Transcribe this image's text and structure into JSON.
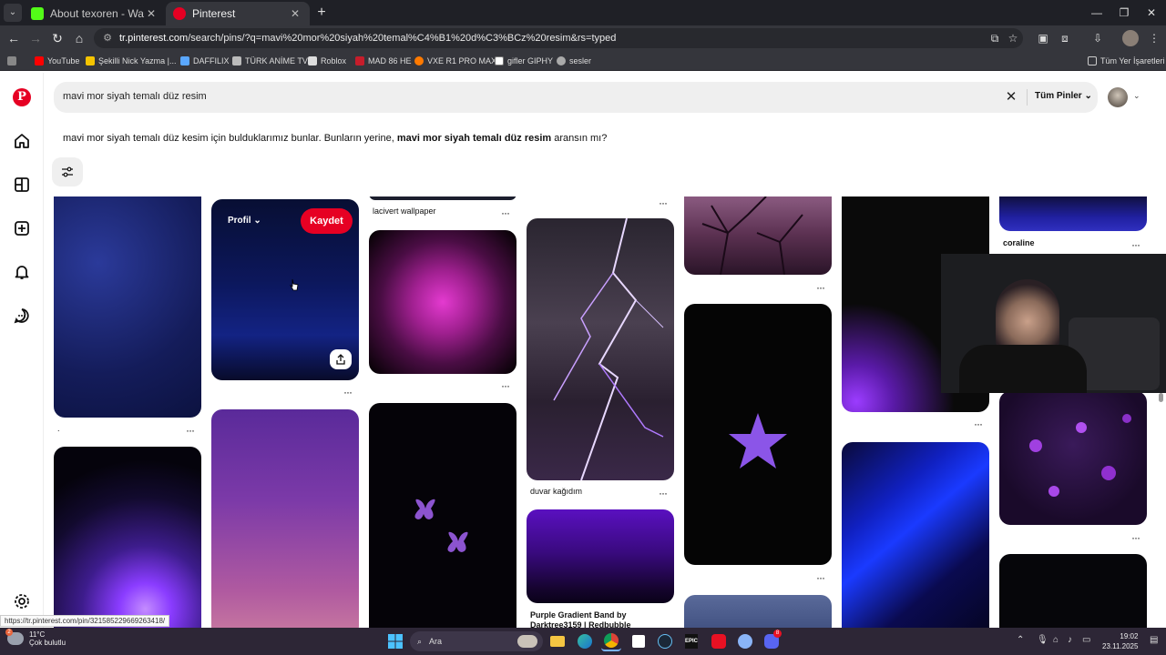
{
  "browser": {
    "tabs": [
      {
        "title": "About texoren - Watch Live on",
        "favicon_color": "#53fc18",
        "active": false
      },
      {
        "title": "Pinterest",
        "favicon_color": "#e60023",
        "active": true
      }
    ],
    "url_host": "tr.pinterest.com",
    "url_path": "/search/pins/?q=mavi%20mor%20siyah%20temal%C4%B1%20d%C3%BCz%20resim&rs=typed",
    "bookmarks": [
      "YouTube",
      "Şekilli Nick Yazma |...",
      "DAFFILIX",
      "TÜRK ANİME TV",
      "Roblox",
      "MAD 86 HE",
      "VXE R1 PRO MAX",
      "gifler GIPHY",
      "sesler"
    ],
    "all_bookmarks_label": "Tüm Yer İşaretleri"
  },
  "search": {
    "query": "mavi mor siyah temalı düz resim",
    "scope_label": "Tüm Pinler"
  },
  "suggestion": {
    "prefix": "mavi mor siyah temalı düz kesim için bulduklarımız bunlar. Bunların yerine, ",
    "term": "mavi mor siyah temalı düz resim",
    "suffix": " aransın mı?"
  },
  "pins": {
    "hover_profile": "Profil",
    "save_button": "Kaydet",
    "captions": {
      "lacivert": "lacivert wallpaper",
      "duvar": "duvar kağıdım",
      "purple_band_1": "Purple Gradient Band by",
      "purple_band_2": "Darktree3159 | Redbubble",
      "coraline": "coraline",
      "dot": "."
    }
  },
  "status_url": "https://tr.pinterest.com/pin/321585229669263418/",
  "taskbar": {
    "weather_temp": "11°C",
    "weather_desc": "Çok bulutlu",
    "weather_badge": "2",
    "search_placeholder": "Ara",
    "time": "19:02",
    "date": "23.11.2025",
    "discord_badge": "8"
  },
  "colors": {
    "pinterest_red": "#e60023",
    "chrome_dark": "#35363c",
    "taskbar": "#2d2636"
  }
}
